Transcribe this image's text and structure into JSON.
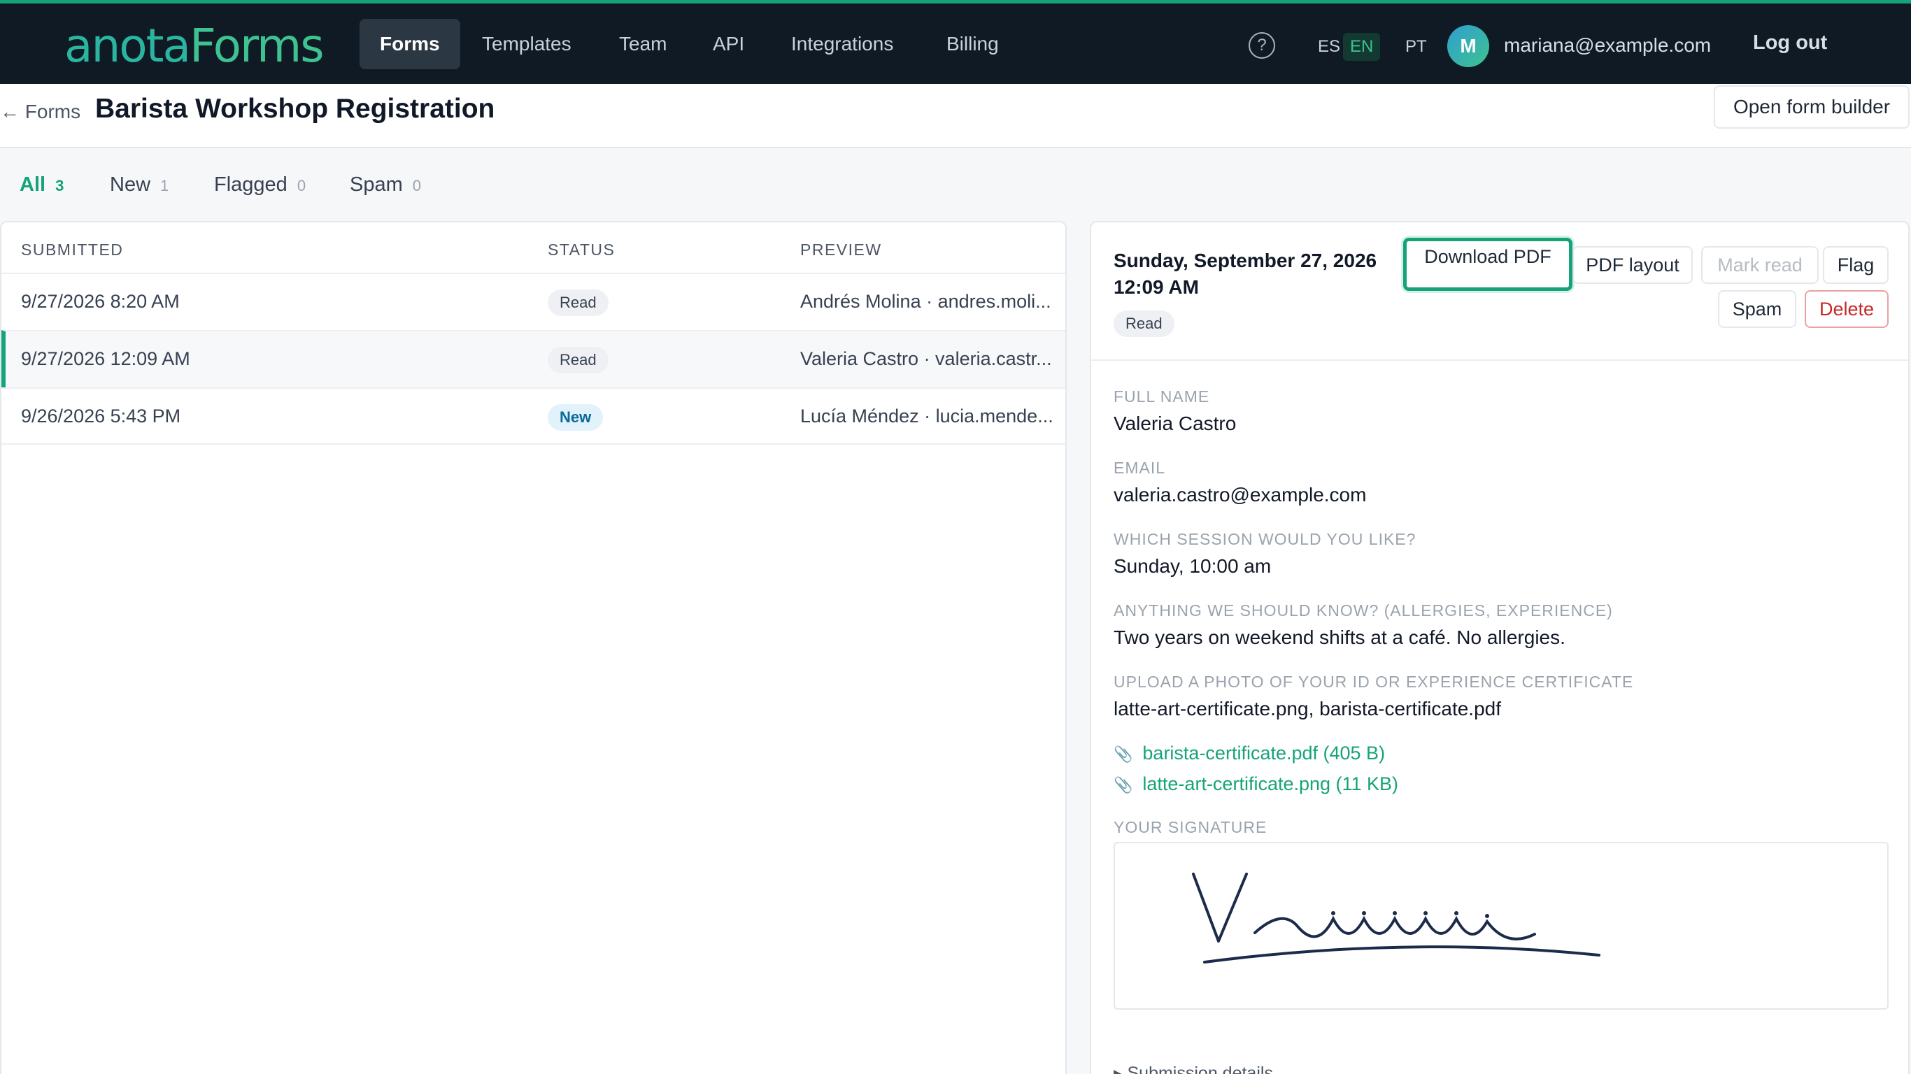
{
  "nav": {
    "logo_a": "anota",
    "logo_b": "Forms",
    "tabs": [
      "Forms",
      "Templates",
      "Team",
      "API",
      "Integrations",
      "Billing"
    ],
    "help_glyph": "?",
    "languages": [
      "ES",
      "EN",
      "PT"
    ],
    "active_language": "EN",
    "avatar_initial": "M",
    "user_email": "mariana@example.com",
    "logout_label": "Log out"
  },
  "header": {
    "back_label": "← Forms",
    "title": "Barista Workshop Registration",
    "open_builder_label": "Open form builder"
  },
  "filters": [
    {
      "label": "All",
      "count": "3"
    },
    {
      "label": "New",
      "count": "1"
    },
    {
      "label": "Flagged",
      "count": "0"
    },
    {
      "label": "Spam",
      "count": "0"
    }
  ],
  "table": {
    "columns": [
      "SUBMITTED",
      "STATUS",
      "PREVIEW"
    ],
    "rows": [
      {
        "submitted": "9/27/2026 8:20 AM",
        "status": "Read",
        "preview": "Andrés Molina · andres.moli..."
      },
      {
        "submitted": "9/27/2026 12:09 AM",
        "status": "Read",
        "preview": "Valeria Castro · valeria.castr..."
      },
      {
        "submitted": "9/26/2026 5:43 PM",
        "status": "New",
        "preview": "Lucía Méndez · lucia.mende..."
      }
    ]
  },
  "detail": {
    "date_line1": "Sunday, September 27, 2026",
    "date_line2": "12:09 AM",
    "status": "Read",
    "buttons": {
      "download_pdf": "Download PDF",
      "pdf_layout": "PDF layout",
      "mark_read": "Mark read",
      "flag": "Flag",
      "spam": "Spam",
      "delete": "Delete"
    },
    "fields": [
      {
        "label": "FULL NAME",
        "value": "Valeria Castro"
      },
      {
        "label": "EMAIL",
        "value": "valeria.castro@example.com"
      },
      {
        "label": "WHICH SESSION WOULD YOU LIKE?",
        "value": "Sunday, 10:00 am"
      },
      {
        "label": "ANYTHING WE SHOULD KNOW? (ALLERGIES, EXPERIENCE)",
        "value": "Two years on weekend shifts at a café. No allergies."
      },
      {
        "label": "UPLOAD A PHOTO OF YOUR ID OR EXPERIENCE CERTIFICATE",
        "value": "latte-art-certificate.png, barista-certificate.pdf"
      }
    ],
    "attachments": [
      "barista-certificate.pdf (405 B)",
      "latte-art-certificate.png (11 KB)"
    ],
    "signature_label": "YOUR SIGNATURE",
    "submission_details_label": "▸ Submission details"
  },
  "colors": {
    "accent": "#16a37a",
    "nav_bg": "#0f1a24",
    "danger": "#c62828",
    "new_badge": "#e2f2fb"
  },
  "icons": [
    "help-icon",
    "paperclip-icon",
    "back-arrow-icon"
  ]
}
